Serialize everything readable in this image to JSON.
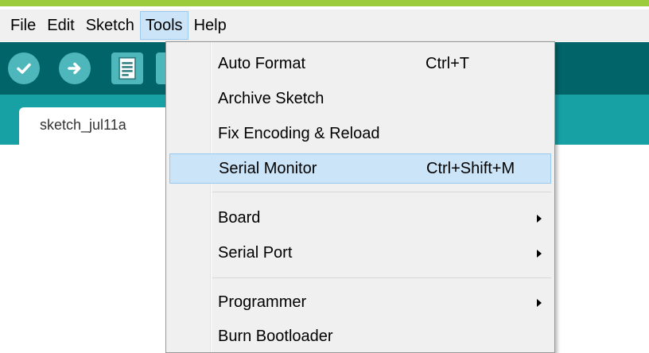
{
  "menubar": {
    "items": [
      {
        "label": "File"
      },
      {
        "label": "Edit"
      },
      {
        "label": "Sketch"
      },
      {
        "label": "Tools",
        "active": true
      },
      {
        "label": "Help"
      }
    ]
  },
  "toolbar": {
    "buttons": [
      {
        "icon": "checkmark-icon",
        "action": "verify"
      },
      {
        "icon": "arrow-right-icon",
        "action": "upload"
      },
      {
        "icon": "document-icon",
        "action": "new"
      }
    ]
  },
  "tabs": [
    {
      "label": "sketch_jul11a"
    }
  ],
  "tools_menu": {
    "items": [
      {
        "label": "Auto Format",
        "shortcut": "Ctrl+T"
      },
      {
        "label": "Archive Sketch",
        "shortcut": ""
      },
      {
        "label": "Fix Encoding & Reload",
        "shortcut": ""
      },
      {
        "label": "Serial Monitor",
        "shortcut": "Ctrl+Shift+M",
        "highlighted": true
      },
      {
        "label": "Board",
        "submenu": true
      },
      {
        "label": "Serial Port",
        "submenu": true
      },
      {
        "label": "Programmer",
        "submenu": true
      },
      {
        "label": "Burn Bootloader",
        "shortcut": ""
      }
    ]
  },
  "colors": {
    "accent_top": "#9ccc3b",
    "toolbar_bg": "#006468",
    "toolbar_button": "#4db7bb",
    "tabstrip_bg": "#17a1a5",
    "menu_highlight": "#cce4f7"
  }
}
